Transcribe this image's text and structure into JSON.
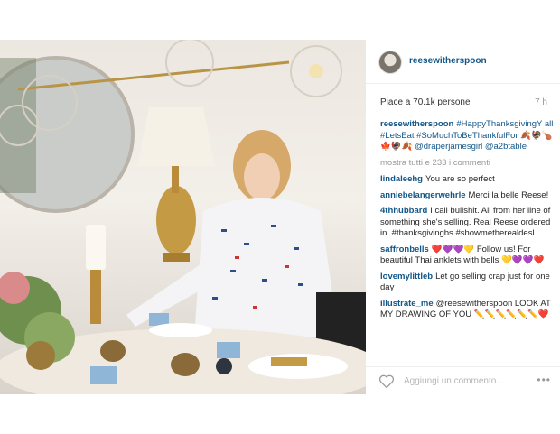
{
  "post": {
    "username": "reesewitherspoon",
    "likes": "Piace a 70.1k persone",
    "time_ago": "7 h",
    "view_all": "mostra tutti e 233 i commenti",
    "caption": {
      "user": "reesewitherspoon",
      "text": "#HappyThanksgivingY all #LetsEat #SoMuchToBeThankfulFor 🍂🦃🍗🍁🦃🍂 @draperjamesgirl @a2btable"
    },
    "comments": [
      {
        "user": "lindaleehg",
        "text": "You are so perfect"
      },
      {
        "user": "anniebelangerwehrle",
        "text": "Merci la belle Reese!"
      },
      {
        "user": "4thhubbard",
        "text": "I call bullshit. All from her line of something she's selling. Real Reese ordered in. #thanksgivingbs #showmetherealdesl"
      },
      {
        "user": "saffronbells",
        "text": "❤️💜💜💛 Follow us! For beautiful Thai anklets with bells 💛💜💜❤️"
      },
      {
        "user": "lovemylittleb",
        "text": "Let go selling crap just for one day"
      },
      {
        "user": "illustrate_me",
        "text": "@reesewitherspoon LOOK AT MY DRAWING OF YOU ✏️✏️✏️✏️✏️✏️❤️"
      }
    ],
    "add_comment_placeholder": "Aggiungi un commento...",
    "more_options": "•••"
  }
}
